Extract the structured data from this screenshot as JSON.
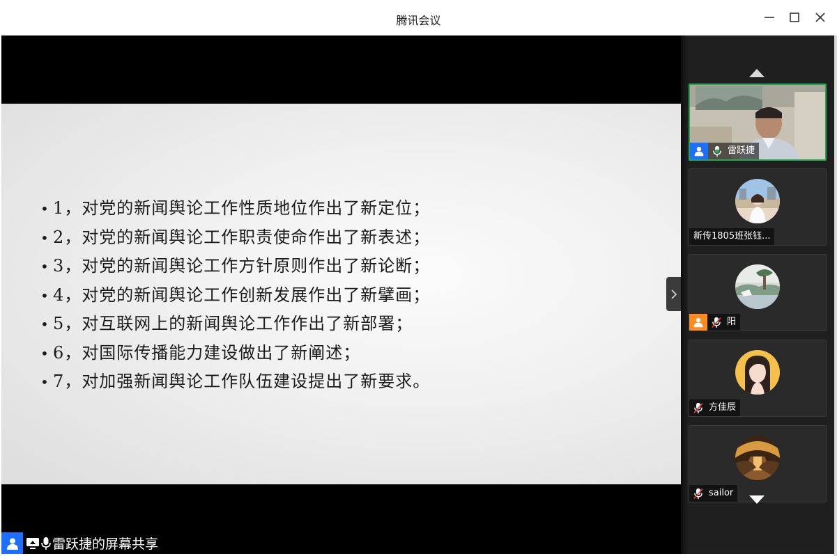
{
  "window": {
    "title": "腾讯会议",
    "controls": {
      "minimize": "minimize-icon",
      "maximize": "maximize-icon",
      "close": "close-icon"
    }
  },
  "slide": {
    "items": [
      "1，对党的新闻舆论工作性质地位作出了新定位；",
      "2，对党的新闻舆论工作职责使命作出了新表述；",
      "3，对党的新闻舆论工作方针原则作出了新论断；",
      "4，对党的新闻舆论工作创新发展作出了新擘画；",
      "5，对互联网上的新闻舆论工作作出了新部署；",
      "6，对国际传播能力建设做出了新阐述；",
      "7，对加强新闻舆论工作队伍建设提出了新要求。"
    ]
  },
  "share": {
    "label": "雷跃捷的屏幕共享"
  },
  "participants": [
    {
      "name": "雷跃捷",
      "role": "host",
      "mic": "on",
      "video": true
    },
    {
      "name": "新传1805班张钰...",
      "mic": "none",
      "video": false
    },
    {
      "name": "阳",
      "role": "cohost",
      "mic": "muted",
      "video": false
    },
    {
      "name": "方佳辰",
      "mic": "muted",
      "video": false
    },
    {
      "name": "sailor",
      "mic": "muted",
      "video": false
    }
  ],
  "colors": {
    "host_badge": "#1e6fff",
    "cohost_badge": "#ff8a1f",
    "active_border": "#1faa4f",
    "panel": "#1f1f1f"
  }
}
